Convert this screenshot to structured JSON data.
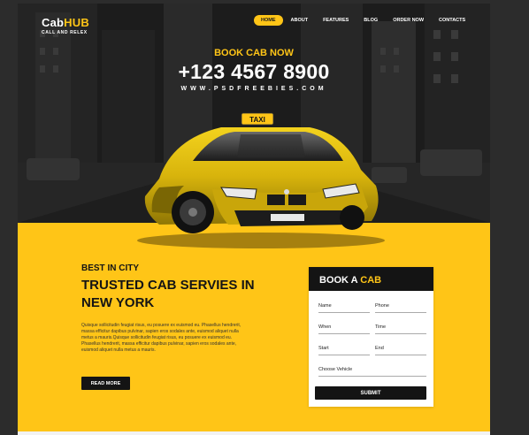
{
  "logo": {
    "brand_a": "Cab",
    "brand_b": "HUB",
    "tagline": "CALL AND RELEX"
  },
  "nav": {
    "items": [
      "HOME",
      "ABOUT",
      "FEATURES",
      "BLOG",
      "ORDER NOW",
      "CONTACTS"
    ],
    "active": "HOME"
  },
  "hero": {
    "book_label": "BOOK CAB NOW",
    "phone": "+123 4567 8900",
    "website": "WWW.PSDFREEBIES.COM",
    "taxi_sign": "TAXI"
  },
  "about": {
    "kicker": "BEST IN CITY",
    "title": "TRUSTED CAB SERVIES IN NEW YORK",
    "text": "Quisque sollicitudin feugiat risus, eu posuere ex euismod eu. Phasellus hendrerit, massa efficitur dapibus pulvinar, sapien eros sodales ante, euismod aliquet nulla metus a mauris.Quisque sollicitudin feugiat risus, eu posuere ex euismod eu. Phasellus hendrerit, massa efficitur dapibus pulvinar, sapien eros sodales ante, euismod aliquet nulla metus a mauris.",
    "button": "READ MORE"
  },
  "booking": {
    "title_a": "BOOK A",
    "title_b": "CAB",
    "fields": {
      "name": "Name",
      "phone": "Phone",
      "when": "When",
      "time": "Time",
      "start": "Start",
      "end": "End",
      "vehicle": "Choose Vehicle"
    },
    "submit": "SUBMIT"
  },
  "colors": {
    "accent": "#ffc517",
    "dark": "#141414",
    "white": "#ffffff"
  }
}
